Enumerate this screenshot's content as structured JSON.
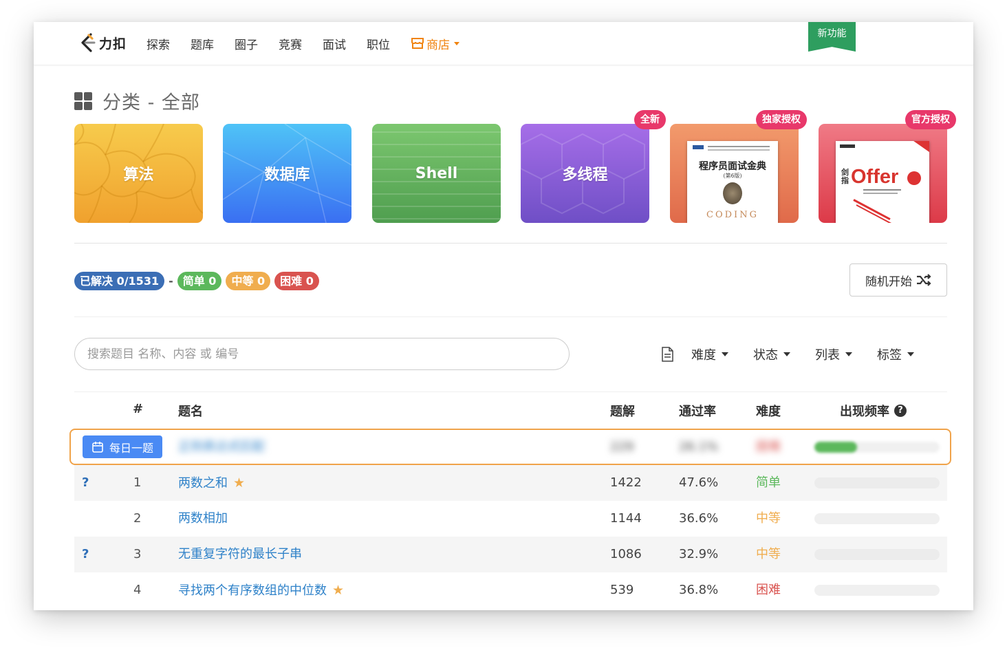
{
  "header": {
    "logo_text": "力扣",
    "nav": [
      "探索",
      "题库",
      "圈子",
      "竞赛",
      "面试",
      "职位"
    ],
    "store": "商店",
    "new_badge": "新功能"
  },
  "category": {
    "title": "分类 - 全部"
  },
  "cards": [
    {
      "label": "算法"
    },
    {
      "label": "数据库"
    },
    {
      "label": "Shell"
    },
    {
      "label": "多线程"
    }
  ],
  "ribbons": [
    "全新",
    "独家授权",
    "官方授权"
  ],
  "books": [
    {
      "title": "程序员面试金典",
      "subtitle": "(第6版)",
      "art": "CODING"
    },
    {
      "title_top": "剑",
      "title_bottom": "指",
      "title_big": "Offer"
    }
  ],
  "stats": {
    "solved": "已解决 0/1531",
    "dash": "-",
    "easy": "简单 0",
    "medium": "中等 0",
    "hard": "困难 0"
  },
  "random_button": "随机开始",
  "search": {
    "placeholder": "搜索题目 名称、内容 或 编号"
  },
  "filters": [
    "难度",
    "状态",
    "列表",
    "标签"
  ],
  "table": {
    "headers": {
      "num": "#",
      "title": "题名",
      "solutions": "题解",
      "acceptance": "通过率",
      "difficulty": "难度",
      "frequency": "出现频率"
    },
    "daily": {
      "badge": "每日一题",
      "title": "正则表达式匹配",
      "solutions": "229",
      "acceptance": "26.1%",
      "difficulty": "困难",
      "frequency": 0.34
    },
    "rows": [
      {
        "status": "?",
        "num": "1",
        "title": "两数之和",
        "star": true,
        "solutions": "1422",
        "acceptance": "47.6%",
        "difficulty": "简单",
        "frequency": 0
      },
      {
        "status": "",
        "num": "2",
        "title": "两数相加",
        "star": false,
        "solutions": "1144",
        "acceptance": "36.6%",
        "difficulty": "中等",
        "frequency": 0
      },
      {
        "status": "?",
        "num": "3",
        "title": "无重复字符的最长子串",
        "star": false,
        "solutions": "1086",
        "acceptance": "32.9%",
        "difficulty": "中等",
        "frequency": 0
      },
      {
        "status": "",
        "num": "4",
        "title": "寻找两个有序数组的中位数",
        "star": true,
        "solutions": "539",
        "acceptance": "36.8%",
        "difficulty": "困难",
        "frequency": 0
      }
    ]
  },
  "colors": {
    "easy": "#5cb85c",
    "medium": "#f0ad4e",
    "hard": "#d9534f",
    "solved": "#3b6eb5",
    "link": "#2f82c9",
    "store": "#f0830e",
    "daily_border": "#f0a34a",
    "ribbon": "#e8386a"
  }
}
